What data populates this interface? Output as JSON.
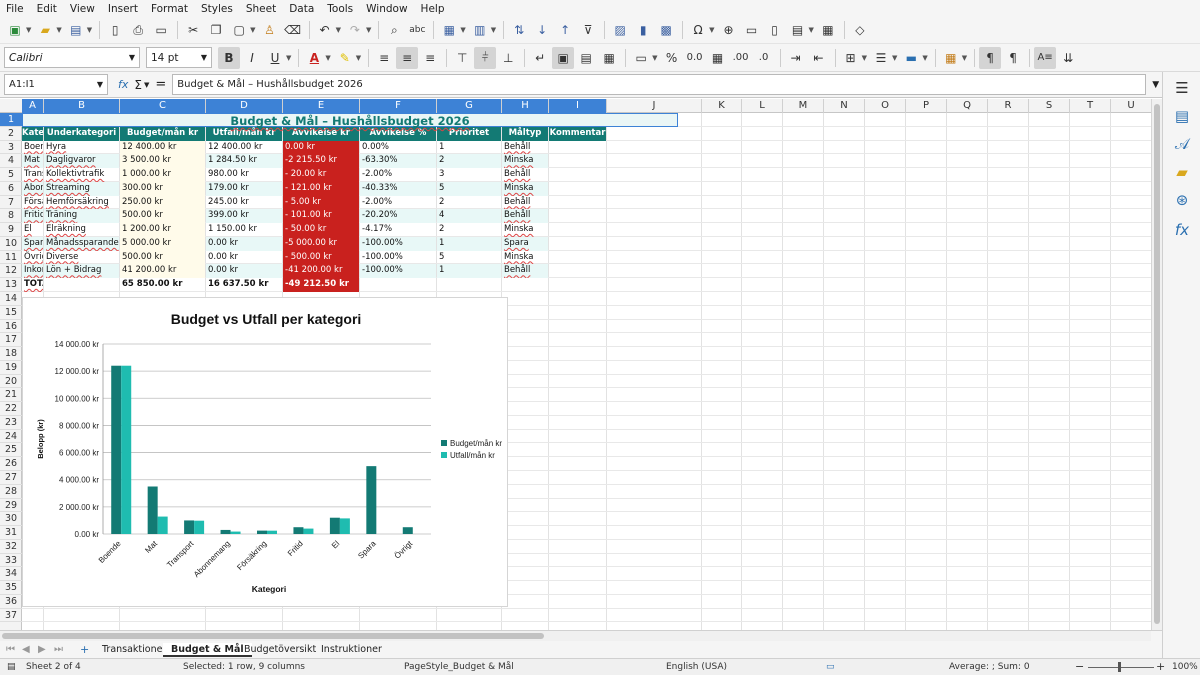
{
  "menu": [
    "File",
    "Edit",
    "View",
    "Insert",
    "Format",
    "Styles",
    "Sheet",
    "Data",
    "Tools",
    "Window",
    "Help"
  ],
  "format": {
    "font": "Calibri",
    "size": "14 pt"
  },
  "formula_bar": {
    "name_box": "A1:I1",
    "fx": "fx",
    "sigma": "Σ",
    "equals": "=",
    "content": "Budget & Mål – Hushållsbudget 2026"
  },
  "columns": [
    "A",
    "B",
    "C",
    "D",
    "E",
    "F",
    "G",
    "H",
    "I",
    "J",
    "K",
    "L",
    "M",
    "N",
    "O",
    "P",
    "Q",
    "R",
    "S",
    "T",
    "U"
  ],
  "rows": [
    "1",
    "2",
    "3",
    "4",
    "5",
    "6",
    "7",
    "8",
    "9",
    "10",
    "11",
    "12",
    "13",
    "14",
    "15",
    "16",
    "17",
    "18",
    "19",
    "20",
    "21",
    "22",
    "23",
    "24",
    "25",
    "26",
    "27",
    "28",
    "29",
    "30",
    "31",
    "32",
    "33",
    "34",
    "35",
    "36",
    "37"
  ],
  "sheet": {
    "title": "Budget & Mål – Hushållsbudget 2026",
    "headers": [
      "Kategori",
      "Underkategori",
      "Budget/mån kr",
      "Utfall/mån kr",
      "Avvikelse kr",
      "Avvikelse %",
      "Prioritet",
      "Måltyp",
      "Kommentar"
    ],
    "data": [
      [
        "Boende",
        "Hyra",
        "12 400.00 kr",
        "12 400.00 kr",
        "0.00 kr",
        "0.00%",
        "1",
        "Behåll"
      ],
      [
        "Mat",
        "Dagligvaror",
        "3 500.00 kr",
        "1 284.50 kr",
        "-2 215.50 kr",
        "-63.30%",
        "2",
        "Minska"
      ],
      [
        "Transport",
        "Kollektivtrafik",
        "1 000.00 kr",
        "980.00 kr",
        "- 20.00 kr",
        "-2.00%",
        "3",
        "Behåll"
      ],
      [
        "Abonnemang",
        "Streaming",
        "300.00 kr",
        "179.00 kr",
        "- 121.00 kr",
        "-40.33%",
        "5",
        "Minska"
      ],
      [
        "Försäkring",
        "Hemförsäkring",
        "250.00 kr",
        "245.00 kr",
        "- 5.00 kr",
        "-2.00%",
        "2",
        "Behåll"
      ],
      [
        "Fritid",
        "Träning",
        "500.00 kr",
        "399.00 kr",
        "- 101.00 kr",
        "-20.20%",
        "4",
        "Behåll"
      ],
      [
        "El",
        "Elräkning",
        "1 200.00 kr",
        "1 150.00 kr",
        "- 50.00 kr",
        "-4.17%",
        "2",
        "Minska"
      ],
      [
        "Spara",
        "Månadssparande",
        "5 000.00 kr",
        "0.00 kr",
        "-5 000.00 kr",
        "-100.00%",
        "1",
        "Spara"
      ],
      [
        "Övrigt",
        "Diverse",
        "500.00 kr",
        "0.00 kr",
        "- 500.00 kr",
        "-100.00%",
        "5",
        "Minska"
      ],
      [
        "Inkomst",
        "Lön + Bidrag",
        "41 200.00 kr",
        "0.00 kr",
        "-41 200.00 kr",
        "-100.00%",
        "1",
        "Behåll"
      ]
    ],
    "total": [
      "TOTALT",
      "",
      "65 850.00 kr",
      "16 637.50 kr",
      "-49 212.50 kr",
      "",
      "",
      ""
    ]
  },
  "chart_data": {
    "type": "bar",
    "title": "Budget vs Utfall per kategori",
    "xlabel": "Kategori",
    "ylabel": "Belopp (kr)",
    "categories": [
      "Boende",
      "Mat",
      "Transport",
      "Abonnemang",
      "Försäkring",
      "Fritid",
      "El",
      "Spara",
      "Övrigt"
    ],
    "series": [
      {
        "name": "Budget/mån kr",
        "values": [
          12400,
          3500,
          1000,
          300,
          250,
          500,
          1200,
          5000,
          500
        ],
        "color": "#137a74"
      },
      {
        "name": "Utfall/mån kr",
        "values": [
          12400,
          1284.5,
          980,
          179,
          245,
          399,
          1150,
          0,
          0
        ],
        "color": "#1fbcb0"
      }
    ],
    "ylim": [
      0,
      14000
    ],
    "yticks": [
      "0.00 kr",
      "2 000.00 kr",
      "4 000.00 kr",
      "6 000.00 kr",
      "8 000.00 kr",
      "10 000.00 kr",
      "12 000.00 kr",
      "14 000.00 kr"
    ],
    "legend": "right",
    "grid": true
  },
  "tabs": [
    "Transaktioner",
    "Budget & Mål",
    "Budgetöversikt",
    "Instruktioner"
  ],
  "status": {
    "sheet": "Sheet 2 of 4",
    "selection": "Selected: 1 row, 9 columns",
    "pagestyle": "PageStyle_Budget & Mål",
    "language": "English (USA)",
    "sum": "Average: ; Sum: 0",
    "zoom": "100%"
  },
  "colors": {
    "header_teal": "#137a74",
    "negative_red": "#c9211e",
    "select_blue": "#3d82d6"
  }
}
